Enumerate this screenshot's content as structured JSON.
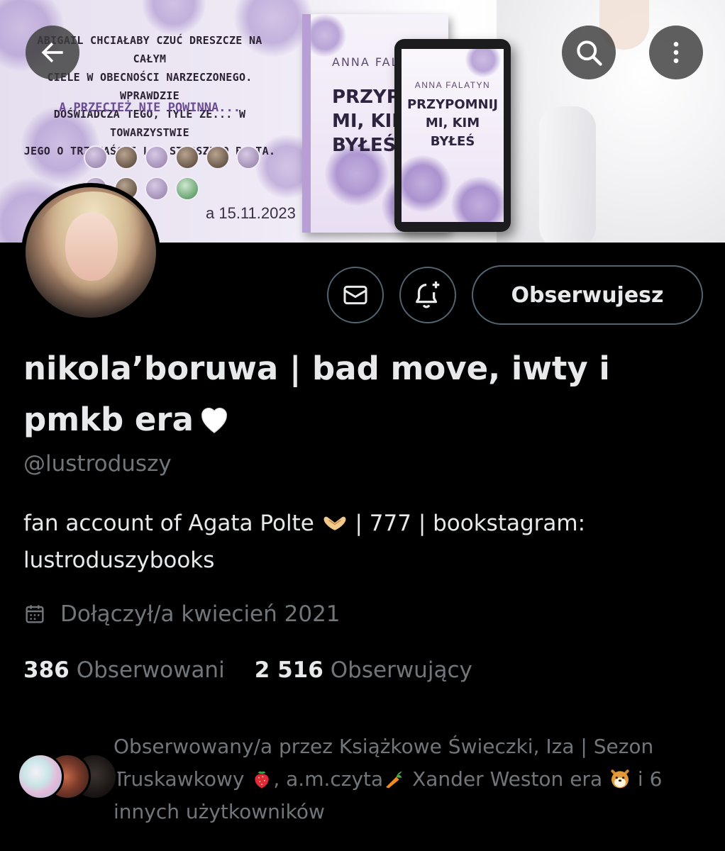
{
  "banner": {
    "blurb_lines": [
      "ABIGAIL CHCIAŁABY CZUĆ DRESZCZE NA CAŁYM",
      "CIELE W OBECNOŚCI NARZECZONEGO. WPRAWDZIE",
      "DOŚWIADCZA TEGO, TYLE ŻE... W TOWARZYSTWIE",
      "JEGO O TRZYNAŚCIE LAT STARSZEGO BRATA."
    ],
    "quote": "A PRZECIEŻ NIE POWINNA...",
    "date": "a 15.11.2023",
    "book_author": "ANNA FALATYN",
    "book_title_lines": [
      "PRZYPOMNIJ",
      "MI, KIM",
      "BYŁEŚ"
    ]
  },
  "nav": {
    "back_icon": "arrow-left-icon",
    "search_icon": "search-icon",
    "more_icon": "more-vertical-icon"
  },
  "actions": {
    "message_icon": "envelope-icon",
    "notify_icon": "bell-plus-icon",
    "follow_label": "Obserwujesz"
  },
  "profile": {
    "display_name": "nikola’boruwa | bad move, iwty i pmkb era",
    "display_name_emoji": "white-heart-icon",
    "handle": "@lustroduszy",
    "bio_part1": "fan account of Agata Polte",
    "bio_emoji": "heart-hands-icon",
    "bio_part2": " | 777 | bookstagram: lustroduszybooks",
    "joined_icon": "calendar-icon",
    "joined": "Dołączył/a kwiecień 2021",
    "following_count": "386",
    "following_label": "Obserwowani",
    "followers_count": "2 516",
    "followers_label": "Obserwujący"
  },
  "followed_by": {
    "text_part1": "Obserwowany/a przez Książkowe Świeczki, Iza | Sezon Truskawkowy ",
    "emoji1": "strawberry-icon",
    "text_part2": ", a.m.czyta",
    "emoji2": "carrot-icon",
    "text_part3": " Xander Weston era ",
    "emoji3": "dog-face-icon",
    "text_part4": " i 6 innych użytkowników"
  },
  "colors": {
    "background": "#000000",
    "primary_text": "#e7e9ea",
    "secondary_text": "#71767b",
    "border": "#536471"
  }
}
